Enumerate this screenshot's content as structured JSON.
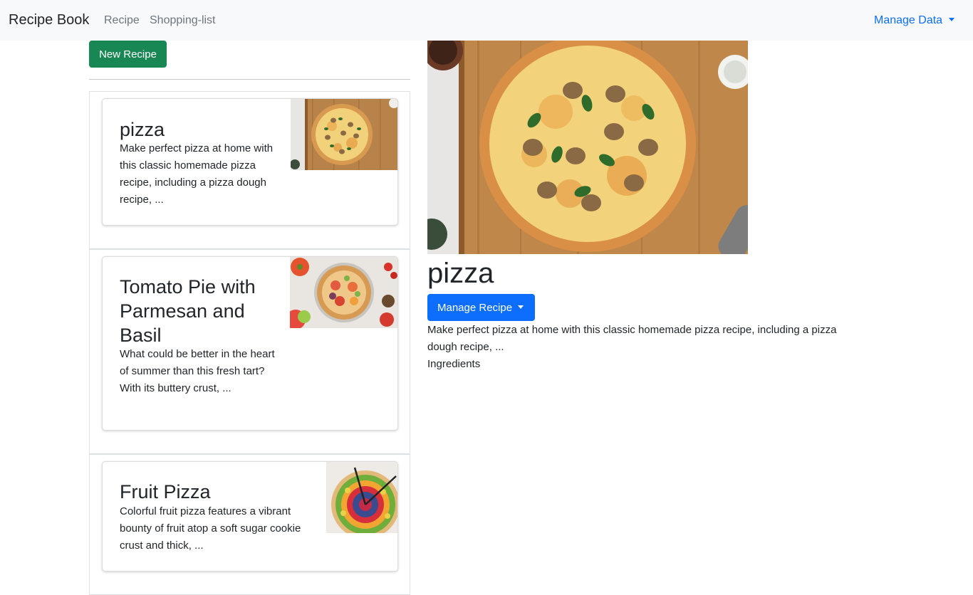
{
  "navbar": {
    "brand": "Recipe Book",
    "links": [
      "Recipe",
      "Shopping-list"
    ],
    "manage_data": "Manage Data"
  },
  "sidebar": {
    "new_recipe_label": "New Recipe",
    "recipes": [
      {
        "name": "pizza",
        "description": "Make perfect pizza at home with this classic homemade pizza recipe, including a pizza dough recipe, ..."
      },
      {
        "name": "Tomato Pie with Parmesan and Basil",
        "description": "What could be better in the heart of summer than this fresh tart? With its buttery crust, ..."
      },
      {
        "name": "Fruit Pizza",
        "description": "Colorful fruit pizza features a vibrant bounty of fruit atop a soft sugar cookie crust and thick, ..."
      }
    ]
  },
  "detail": {
    "name": "pizza",
    "manage_label": "Manage Recipe",
    "description": "Make perfect pizza at home with this classic homemade pizza recipe, including a pizza dough recipe, ...",
    "ingredients_label": "Ingredients"
  },
  "colors": {
    "navbar_bg": "#f8f9fa",
    "success": "#198754",
    "primary": "#0d6efd",
    "text": "#212529",
    "muted": "#6c757d"
  }
}
